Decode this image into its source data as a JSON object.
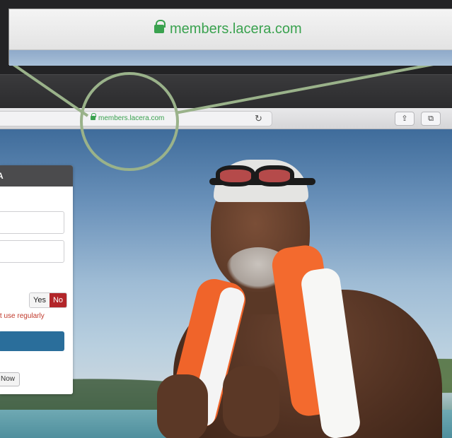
{
  "browser": {
    "url_zoomed": "members.lacera.com",
    "url": "members.lacera.com",
    "reload_icon": "reload-icon",
    "share_icon": "share-icon",
    "tabs_icon": "tabs-icon",
    "lock_icon": "lock-icon"
  },
  "login_panel": {
    "header_text": "A",
    "toggle": {
      "yes_label": "Yes",
      "no_label": "No",
      "selected": "No"
    },
    "warning_text": "'t use regularly",
    "secondary_button_label": "Now"
  },
  "colors": {
    "url_green": "#3aa24f",
    "toggle_selected": "#b2262a",
    "submit_blue": "#2a6e9b",
    "lens_green": "#9ab28a"
  }
}
